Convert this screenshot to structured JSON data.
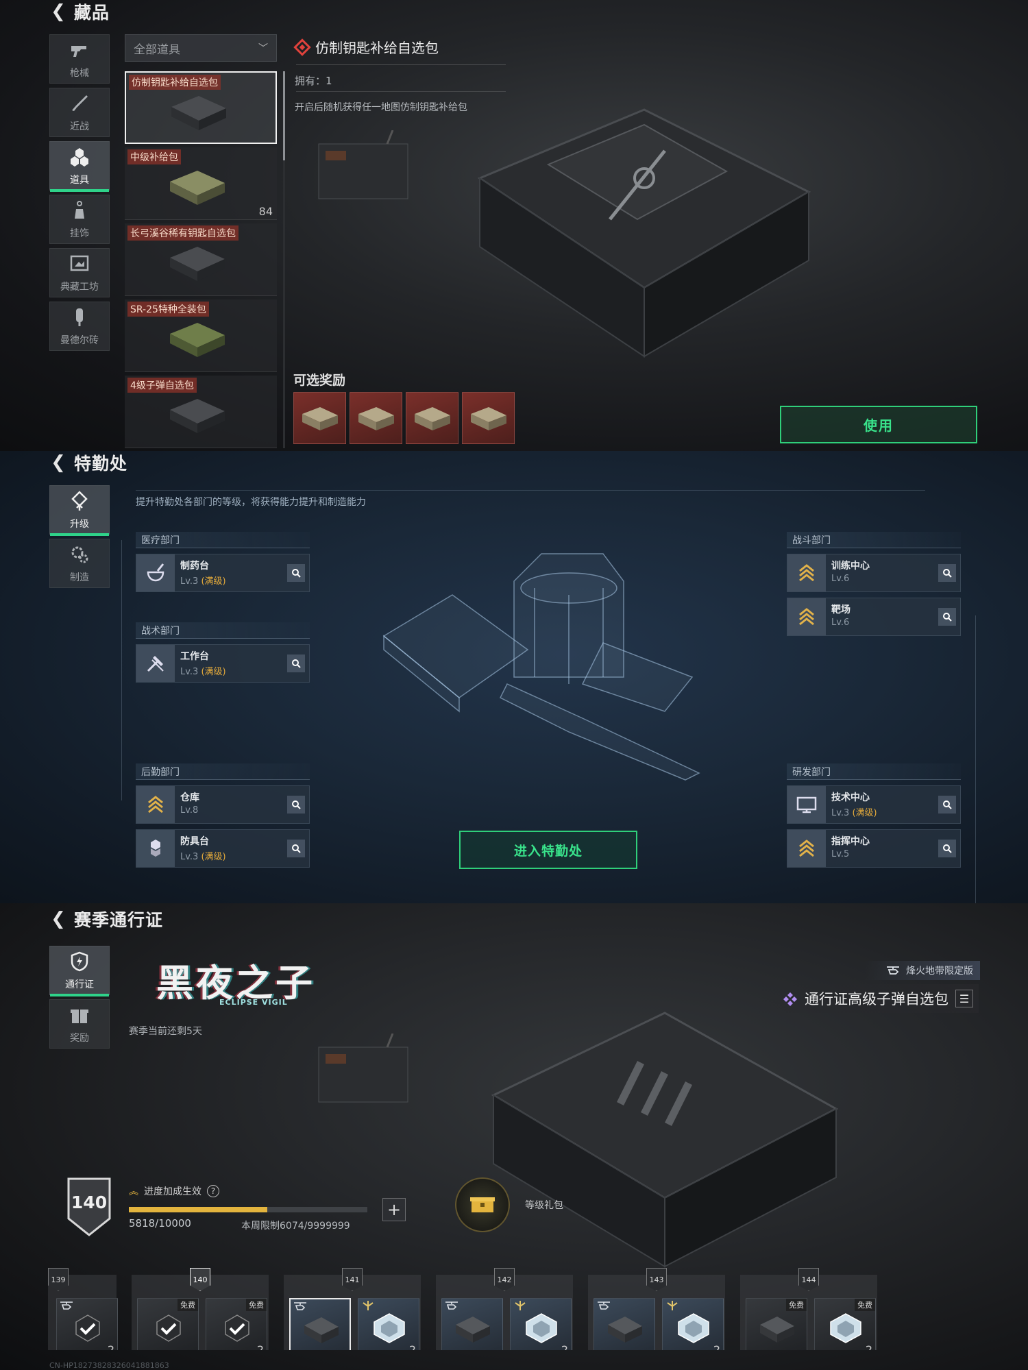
{
  "collection": {
    "title": "藏品",
    "nav": [
      {
        "label": "枪械",
        "icon": "gun-icon",
        "active": false
      },
      {
        "label": "近战",
        "icon": "knife-icon",
        "active": false
      },
      {
        "label": "道具",
        "icon": "items-icon",
        "active": true
      },
      {
        "label": "挂饰",
        "icon": "charm-icon",
        "active": false
      },
      {
        "label": "典藏工坊",
        "icon": "workshop-icon",
        "active": false
      },
      {
        "label": "曼德尔砖",
        "icon": "brick-icon",
        "active": false
      }
    ],
    "filter": "全部道具",
    "items": [
      {
        "name": "仿制钥匙补给自选包",
        "count": "",
        "selected": true
      },
      {
        "name": "中级补给包",
        "count": "84",
        "selected": false
      },
      {
        "name": "长弓溪谷稀有钥匙自选包",
        "count": "",
        "selected": false
      },
      {
        "name": "SR-25特种全装包",
        "count": "",
        "selected": false
      },
      {
        "name": "4级子弹自选包",
        "count": "",
        "selected": false
      }
    ],
    "detail": {
      "title": "仿制钥匙补给自选包",
      "owned": "拥有：1",
      "description": "开启后随机获得任一地图仿制钥匙补给包",
      "rewards_label": "可选奖励",
      "use_label": "使用"
    }
  },
  "agency": {
    "title": "特勤处",
    "nav": [
      {
        "label": "升级",
        "icon": "upgrade-icon",
        "active": true
      },
      {
        "label": "制造",
        "icon": "craft-icon",
        "active": false
      }
    ],
    "hint": "提升特勤处各部门的等级，将获得能力提升和制造能力",
    "departments": {
      "medical": {
        "name": "医疗部门",
        "facilities": [
          {
            "name": "制药台",
            "level": "Lv.3",
            "max": "(满级)"
          }
        ]
      },
      "tactical": {
        "name": "战术部门",
        "facilities": [
          {
            "name": "工作台",
            "level": "Lv.3",
            "max": "(满级)"
          }
        ]
      },
      "logistics": {
        "name": "后勤部门",
        "facilities": [
          {
            "name": "仓库",
            "level": "Lv.8",
            "max": ""
          },
          {
            "name": "防具台",
            "level": "Lv.3",
            "max": "(满级)"
          }
        ]
      },
      "combat": {
        "name": "战斗部门",
        "facilities": [
          {
            "name": "训练中心",
            "level": "Lv.6",
            "max": ""
          },
          {
            "name": "靶场",
            "level": "Lv.6",
            "max": ""
          }
        ]
      },
      "rnd": {
        "name": "研发部门",
        "facilities": [
          {
            "name": "技术中心",
            "level": "Lv.3",
            "max": "(满级)"
          },
          {
            "name": "指挥中心",
            "level": "Lv.5",
            "max": ""
          }
        ]
      }
    },
    "enter_label": "进入特勤处"
  },
  "pass": {
    "title": "赛季通行证",
    "nav": [
      {
        "label": "通行证",
        "icon": "pass-icon",
        "active": true
      },
      {
        "label": "奖励",
        "icon": "gift-icon",
        "active": false
      }
    ],
    "season_name": "黑夜之子",
    "season_sub": "ECLIPSE VIGIL",
    "remaining": "赛季当前还剩5天",
    "edition": "烽火地带限定版",
    "reward_name": "通行证高级子弹自选包",
    "level": "140",
    "boost_label": "进度加成生效",
    "progress_text": "5818/10000",
    "progress": 0.5818,
    "weekly_limit": "本周限制6074/9999999",
    "gift_label": "等级礼包",
    "track": [
      {
        "level": "139",
        "current": false,
        "slots": [
          {
            "free": "",
            "count": "2",
            "claimed": true
          }
        ]
      },
      {
        "level": "140",
        "current": true,
        "slots": [
          {
            "free": "免费",
            "count": "",
            "claimed": true
          },
          {
            "free": "免费",
            "count": "2",
            "claimed": true
          }
        ]
      },
      {
        "level": "141",
        "current": false,
        "slots": [
          {
            "free": "",
            "count": "",
            "claimed": false
          },
          {
            "free": "",
            "count": "2",
            "claimed": false
          }
        ]
      },
      {
        "level": "142",
        "current": false,
        "slots": [
          {
            "free": "",
            "count": "",
            "claimed": false
          },
          {
            "free": "",
            "count": "2",
            "claimed": false
          }
        ]
      },
      {
        "level": "143",
        "current": false,
        "slots": [
          {
            "free": "",
            "count": "",
            "claimed": false
          },
          {
            "free": "",
            "count": "2",
            "claimed": false
          }
        ]
      },
      {
        "level": "144",
        "current": false,
        "slots": [
          {
            "free": "免费",
            "count": "",
            "claimed": false
          },
          {
            "free": "免费",
            "count": "2",
            "claimed": false
          }
        ]
      }
    ],
    "footer": "CN-HP18273828326041881863"
  },
  "colors": {
    "accent_green": "#2fcf7a",
    "tag_red": "#8c3228",
    "max_level_orange": "#e2a93b",
    "progress_gold": "#e3b43e"
  }
}
